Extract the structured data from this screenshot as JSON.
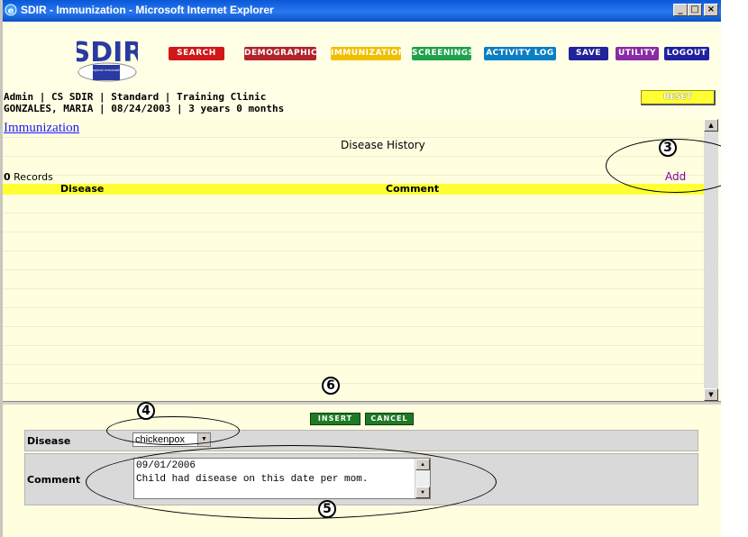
{
  "window": {
    "title": "SDIR - Immunization - Microsoft Internet Explorer",
    "controls": [
      "_",
      "□",
      "×"
    ]
  },
  "logo": {
    "mark": "SDIR",
    "tagline": "san diego regional immunization registry"
  },
  "nav": {
    "tabs": [
      {
        "label": "SEARCH",
        "color": "#d01818"
      },
      {
        "label": "DEMOGRAPHICS",
        "color": "#b2232a"
      },
      {
        "label": "IMMUNIZATION",
        "color": "#f0c000"
      },
      {
        "label": "SCREENINGS",
        "color": "#1ea24a"
      },
      {
        "label": "ACTIVITY LOG",
        "color": "#0a7fc4"
      },
      {
        "label": "SAVE",
        "color": "#22229a"
      },
      {
        "label": "UTILITY",
        "color": "#8a2aa6"
      },
      {
        "label": "LOGOUT",
        "color": "#2020a0"
      }
    ],
    "reset_label": "RESET"
  },
  "context": {
    "line1": "Admin | CS SDIR | Standard | Training Clinic",
    "line2": "GONZALES, MARIA | 08/24/2003 | 3 years 0 months"
  },
  "history": {
    "breadcrumb": "Immunization",
    "title": "Disease History",
    "record_count": "0",
    "records_label": "Records",
    "add_new": "Add New",
    "columns": [
      "Disease",
      "Comment"
    ]
  },
  "form": {
    "insert_label": "INSERT",
    "cancel_label": "CANCEL",
    "disease_label": "Disease",
    "disease_value": "chickenpox",
    "comment_label": "Comment",
    "comment_lines": [
      "09/01/2006",
      "Child had disease on this date per mom."
    ]
  },
  "callouts": {
    "add_new_step": "3",
    "disease_step": "4",
    "comment_step": "5",
    "insert_step": "6"
  }
}
